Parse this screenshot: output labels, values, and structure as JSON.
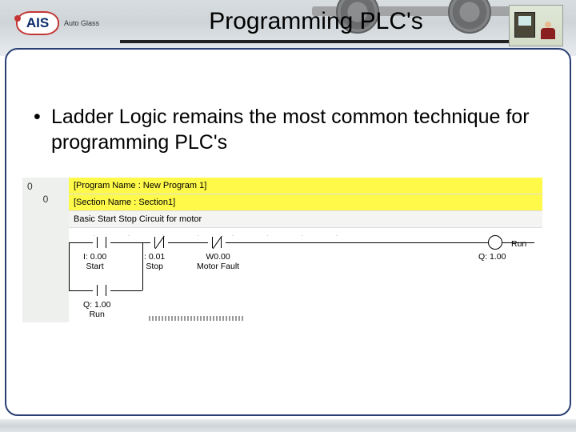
{
  "header": {
    "title": "Programming PLC's",
    "logo_badge": "AIS",
    "logo_sub": "Auto Glass"
  },
  "bullet_text": "Ladder Logic remains the most common technique for programming PLC's",
  "ladder": {
    "gutter_a": "0",
    "gutter_b": "0",
    "band_program": "[Program Name : New Program 1]",
    "band_section": "[Section Name : Section1]",
    "rung_comment": "Basic Start Stop Circuit for motor",
    "contacts": {
      "start": {
        "addr": "I: 0.00",
        "name": "Start"
      },
      "stop": {
        "addr": ": 0.01",
        "name": "Stop"
      },
      "fault": {
        "addr": "W0.00",
        "name": "Motor Fault"
      },
      "seal": {
        "addr": "Q: 1.00",
        "name": "Run"
      }
    },
    "coil": {
      "addr": "Q: 1.00",
      "name": "Run"
    }
  }
}
